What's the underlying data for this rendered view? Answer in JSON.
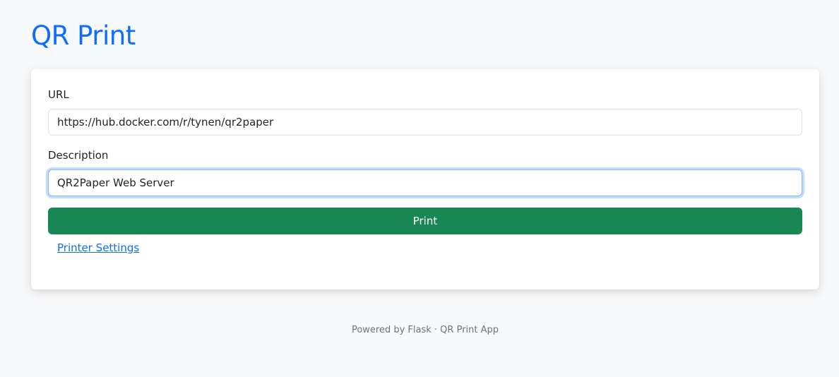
{
  "header": {
    "title": "QR Print"
  },
  "form": {
    "url_label": "URL",
    "url_value": "https://hub.docker.com/r/tynen/qr2paper",
    "description_label": "Description",
    "description_value": "QR2Paper Web Server",
    "print_button": "Print",
    "settings_link": "Printer Settings"
  },
  "footer": {
    "text": "Powered by Flask · QR Print App"
  },
  "colors": {
    "accent": "#0d6efd",
    "success": "#198754",
    "background": "#f8f9fa"
  }
}
